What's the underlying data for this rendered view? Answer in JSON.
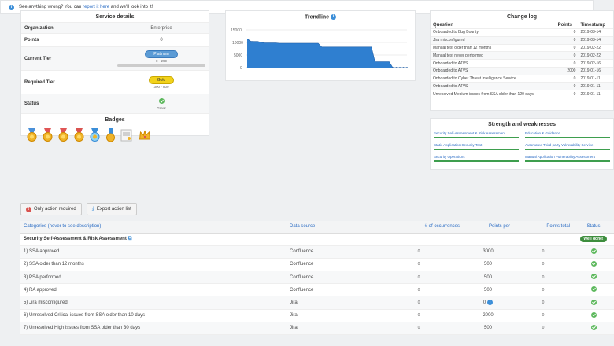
{
  "service": {
    "title": "Service details",
    "rows": [
      {
        "key": "Organization",
        "value": "Enterprise"
      },
      {
        "key": "Points",
        "value": "0"
      }
    ],
    "current_tier_label": "Current Tier",
    "current_tier": "Platinum",
    "current_tier_range": "0 - 299",
    "required_tier_label": "Required Tier",
    "required_tier": "Gold",
    "required_tier_range": "300 - 800",
    "status_label": "Status",
    "status_text": "Great",
    "badges_title": "Badges"
  },
  "trend": {
    "title": "Trendline",
    "yticks": [
      "15000",
      "10000",
      "5000",
      "0"
    ]
  },
  "chart_data": {
    "type": "area",
    "title": "Trendline",
    "ylim": [
      0,
      15000
    ],
    "yticks": [
      0,
      5000,
      10000,
      15000
    ],
    "values": [
      11500,
      10500,
      10400,
      10400,
      10000,
      9800,
      9800,
      9800,
      9800,
      9700,
      9700,
      9700,
      9700,
      9700,
      9700,
      9700,
      9700,
      9700,
      9700,
      9700,
      9700,
      8200,
      8200,
      8200,
      8200,
      8200,
      8200,
      8200,
      8200,
      8200,
      8200,
      8200,
      8200,
      8200,
      8200,
      8200,
      2300,
      2300,
      2300,
      2300,
      2300,
      0,
      0,
      0,
      0,
      0
    ]
  },
  "changelog": {
    "title": "Change log",
    "headers": [
      "Question",
      "Points",
      "Timestamp"
    ],
    "rows": [
      [
        "Onboarded to Bug Bounty",
        "0",
        "2019-03-14"
      ],
      [
        "Jira misconfigured",
        "0",
        "2019-03-14"
      ],
      [
        "Manual test older than 12 months",
        "0",
        "2019-02-22"
      ],
      [
        "Manual test never performed",
        "0",
        "2019-02-22"
      ],
      [
        "Onboarded to ATVS",
        "0",
        "2019-02-16"
      ],
      [
        "Onboarded to ATVS",
        "2000",
        "2019-01-16"
      ],
      [
        "Onboarded to Cyber Threat Intelligence Service",
        "0",
        "2019-01-11"
      ],
      [
        "Onboarded to ATVS",
        "0",
        "2019-01-11"
      ],
      [
        "Unresolved Medium issues from SSA older than 120 days",
        "0",
        "2019-01-11"
      ]
    ]
  },
  "strengths": {
    "title": "Strength and weaknesses",
    "items": [
      "Security Self-Assessment & Risk Assessment",
      "Education & Guidance",
      "Static Application Security Test",
      "Automated Third-party Vulnerability Service",
      "Security Operations",
      "Manual Application Vulnerability Assessment"
    ]
  },
  "alert": {
    "prefix": "See anything wrong? You can ",
    "link": "report it here",
    "suffix": " and we'll look into it!"
  },
  "actions": {
    "only_required": "Only action required",
    "export": "Export action list"
  },
  "table": {
    "headers": [
      "Categories (hover to see description)",
      "Data source",
      "# of occurrences",
      "Points per",
      "Points total",
      "Status"
    ],
    "section": "Security Self-Assessment & Risk Assessment",
    "section_badge": "Well done!",
    "rows": [
      {
        "name": "1) SSA approved",
        "source": "Confluence",
        "occ": "0",
        "per": "3000",
        "total": "0"
      },
      {
        "name": "2) SSA older than 12 months",
        "source": "Confluence",
        "occ": "0",
        "per": "500",
        "total": "0"
      },
      {
        "name": "3) PSA performed",
        "source": "Confluence",
        "occ": "0",
        "per": "500",
        "total": "0"
      },
      {
        "name": "4) RA approved",
        "source": "Confluence",
        "occ": "0",
        "per": "500",
        "total": "0"
      },
      {
        "name": "5) Jira misconfigured",
        "source": "Jira",
        "occ": "0",
        "per": "0",
        "total": "0"
      },
      {
        "name": "6) Unresolved Critical issues from SSA older than 10 days",
        "source": "Jira",
        "occ": "0",
        "per": "2000",
        "total": "0"
      },
      {
        "name": "7) Unresolved High issues from SSA older than 30 days",
        "source": "Jira",
        "occ": "0",
        "per": "500",
        "total": "0"
      }
    ]
  }
}
